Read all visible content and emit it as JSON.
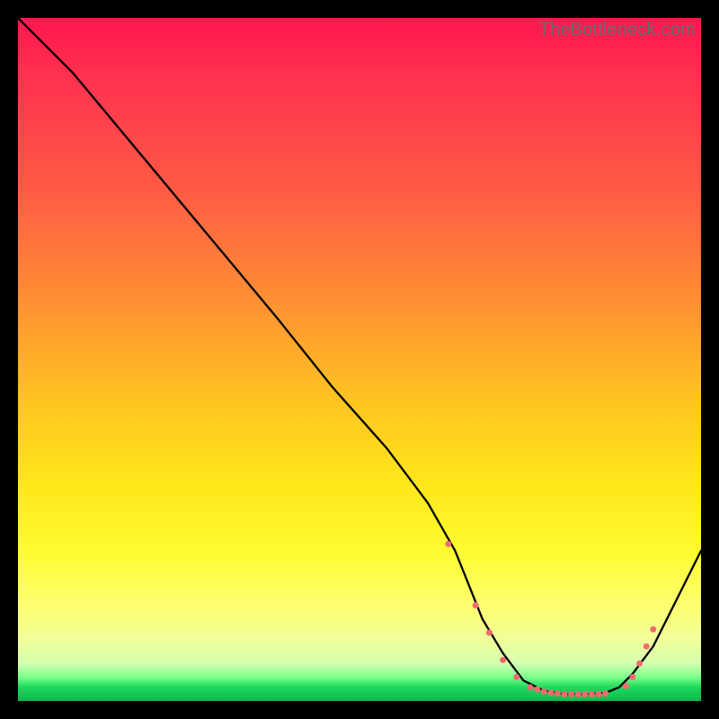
{
  "watermark": "TheBottleneck.com",
  "chart_data": {
    "type": "line",
    "title": "",
    "xlabel": "",
    "ylabel": "",
    "xlim": [
      0,
      100
    ],
    "ylim": [
      0,
      100
    ],
    "grid": false,
    "legend": false,
    "series": [
      {
        "name": "bottleneck-curve",
        "x": [
          0,
          8,
          18,
          28,
          38,
          46,
          54,
          60,
          64,
          66,
          68,
          71,
          74,
          77,
          80,
          83,
          86,
          88,
          90,
          93,
          96,
          100
        ],
        "values": [
          100,
          92,
          80,
          68,
          56,
          46,
          37,
          29,
          22,
          17,
          12,
          7,
          3,
          1.5,
          1.0,
          1.0,
          1.2,
          2.0,
          4.0,
          8.0,
          14,
          22
        ]
      }
    ],
    "markers": {
      "name": "highlight-points",
      "x": [
        63,
        67,
        69,
        71,
        73,
        75,
        76,
        77,
        78,
        79,
        80,
        81,
        82,
        83,
        84,
        85,
        86,
        89,
        90,
        91,
        92,
        93
      ],
      "values": [
        23,
        14,
        10,
        6,
        3.5,
        2.0,
        1.7,
        1.4,
        1.2,
        1.1,
        1.0,
        1.0,
        1.0,
        1.0,
        1.0,
        1.0,
        1.1,
        2.2,
        3.5,
        5.5,
        8.0,
        10.5
      ],
      "color": "#f26a6e",
      "size": 7
    },
    "background_gradient": {
      "top": "#ff1750",
      "mid": "#fff028",
      "bottom": "#11b64c"
    }
  }
}
